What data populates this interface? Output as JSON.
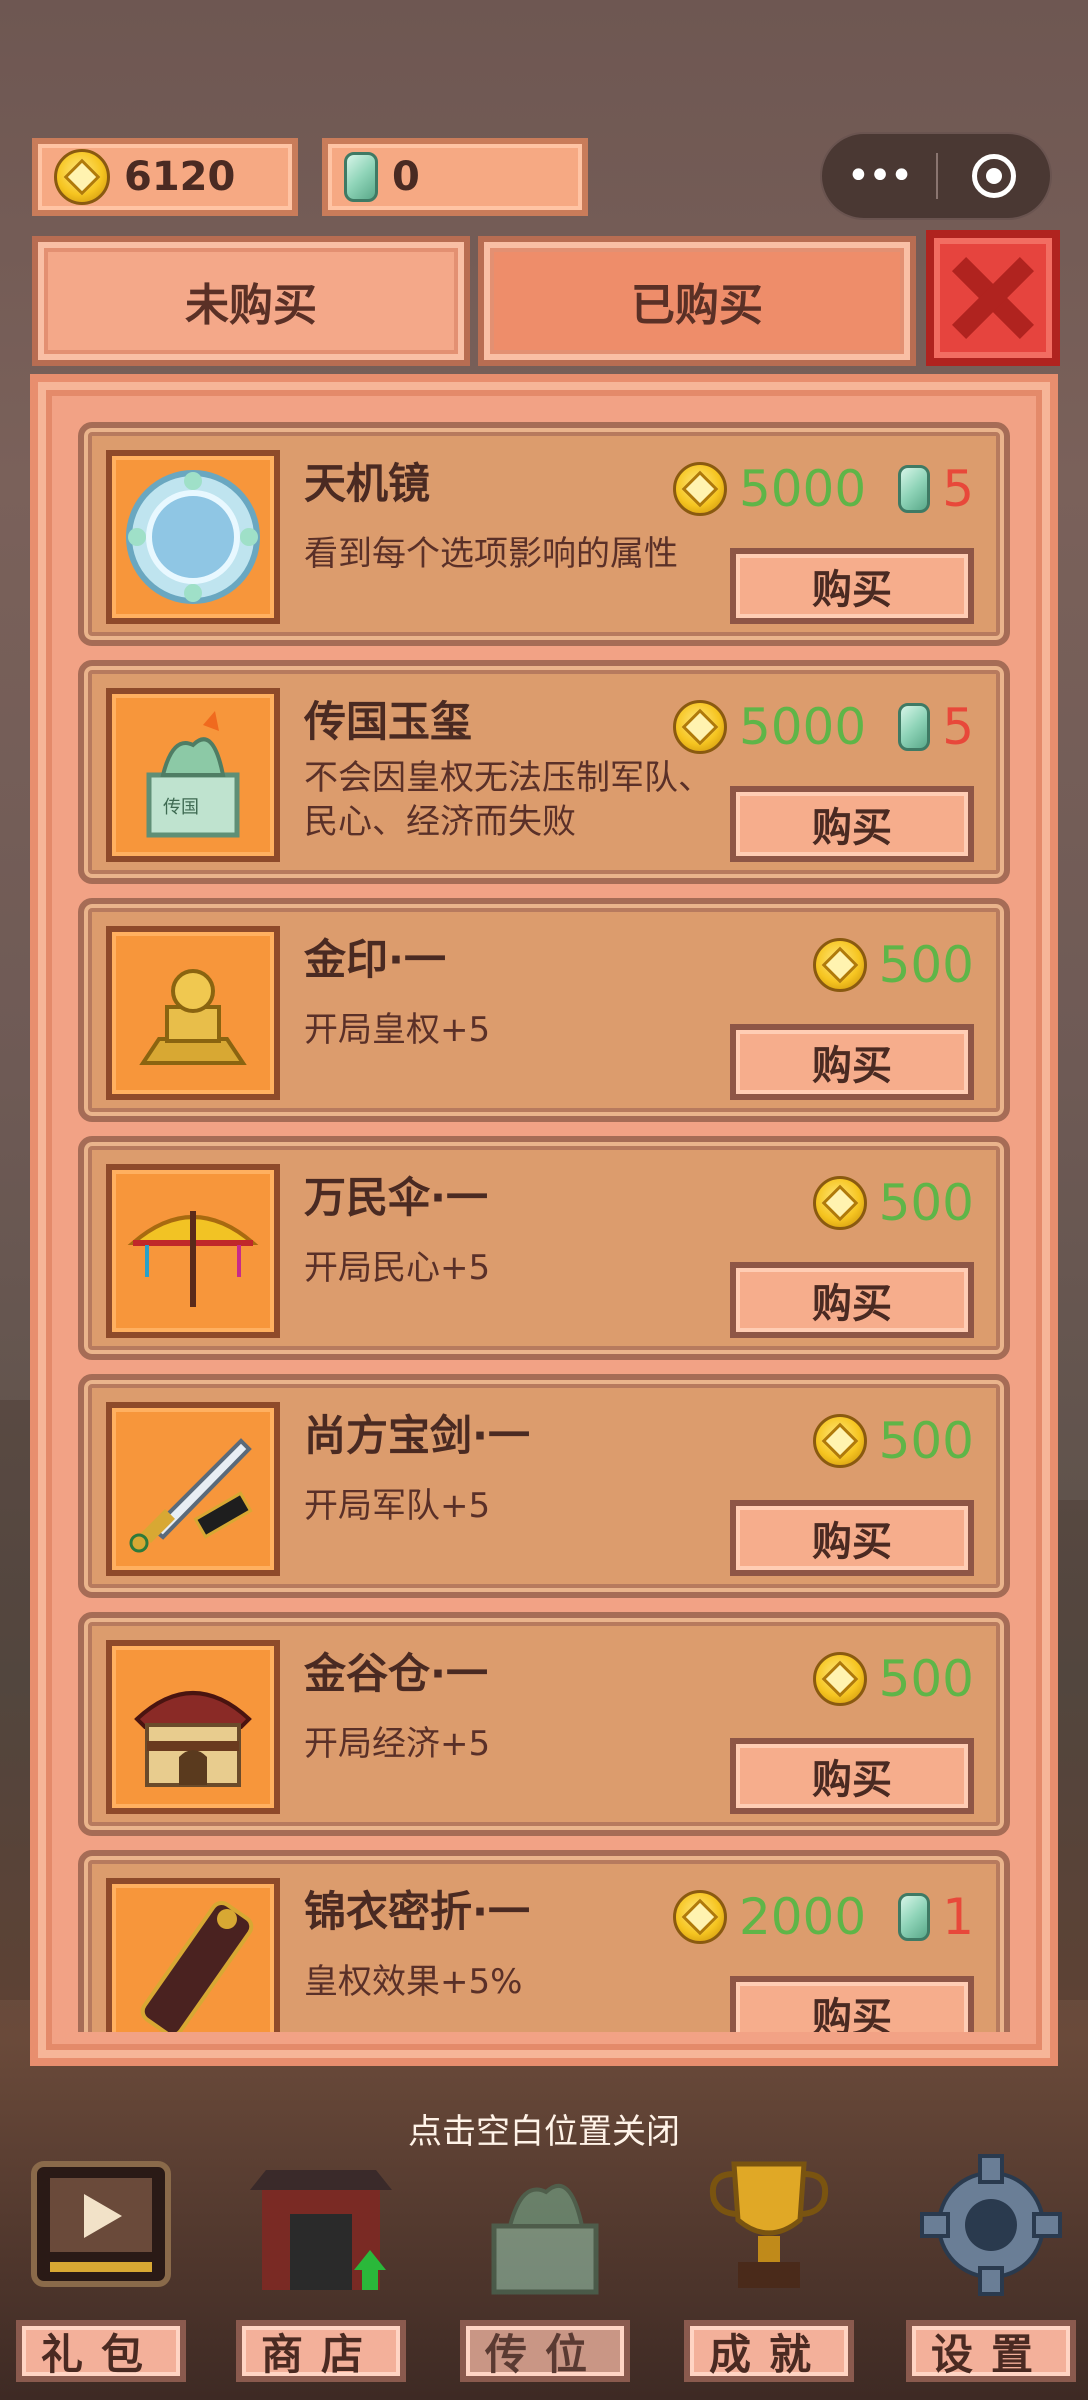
{
  "currency": {
    "gold": "6120",
    "jade": "0"
  },
  "capsule": {
    "more_glyph": "•••"
  },
  "tabs": {
    "unpurchased": "未购买",
    "purchased": "已购买"
  },
  "items": [
    {
      "name": "天机镜",
      "desc": "看到每个选项影响的属性",
      "gold": "5000",
      "jade": "5",
      "buy": "购买",
      "icon": "mirror-icon"
    },
    {
      "name": "传国玉玺",
      "desc": "不会因皇权无法压制军队、民心、经济而失败",
      "gold": "5000",
      "jade": "5",
      "buy": "购买",
      "icon": "jade-seal-icon"
    },
    {
      "name": "金印·一",
      "desc": "开局皇权+5",
      "gold": "500",
      "jade": null,
      "buy": "购买",
      "icon": "gold-seal-icon"
    },
    {
      "name": "万民伞·一",
      "desc": "开局民心+5",
      "gold": "500",
      "jade": null,
      "buy": "购买",
      "icon": "umbrella-icon"
    },
    {
      "name": "尚方宝剑·一",
      "desc": "开局军队+5",
      "gold": "500",
      "jade": null,
      "buy": "购买",
      "icon": "sword-icon"
    },
    {
      "name": "金谷仓·一",
      "desc": "开局经济+5",
      "gold": "500",
      "jade": null,
      "buy": "购买",
      "icon": "granary-icon"
    },
    {
      "name": "锦衣密折·一",
      "desc": "皇权效果+5%",
      "gold": "2000",
      "jade": "1",
      "buy": "购买",
      "icon": "scroll-icon"
    }
  ],
  "hint": "点击空白位置关闭",
  "nav": {
    "gift": "礼包",
    "shop": "商店",
    "throne": "传位",
    "achievement": "成就",
    "settings": "设置"
  },
  "colors": {
    "gold_price": "#5fb548",
    "jade_price": "#e8483a",
    "close": "#e6443e"
  }
}
